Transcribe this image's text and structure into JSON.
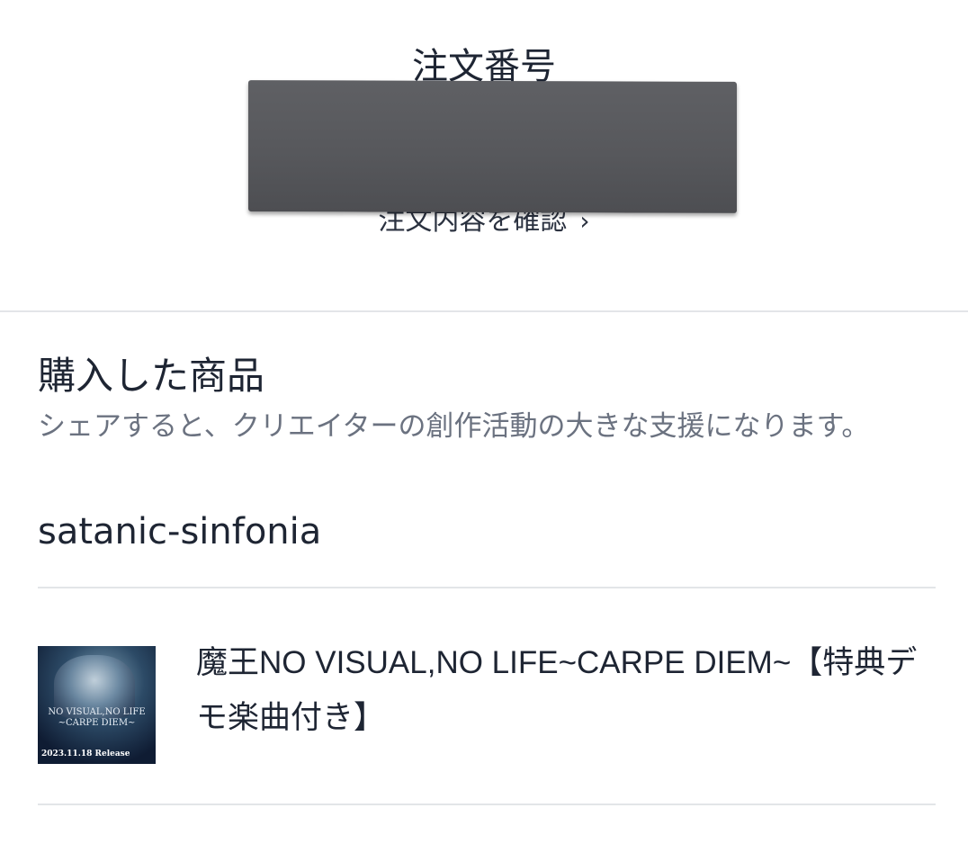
{
  "order": {
    "title": "注文番号",
    "link_label": "注文内容を確認",
    "link_chevron": "›"
  },
  "purchased": {
    "title": "購入した商品",
    "subtitle": "シェアすると、クリエイターの創作活動の大きな支援になります。",
    "creator": "satanic-sinfonia",
    "items": [
      {
        "name": "魔王NO VISUAL,NO LIFE~CARPE DIEM~【特典デモ楽曲付き】",
        "thumb_logo": "NO VISUAL,NO LIFE ~CARPE DIEM~",
        "thumb_date": "2023.11.18 Release"
      }
    ]
  },
  "colors": {
    "text": "#1e2533",
    "subtext": "#6b7280",
    "divider": "#e3e5e8",
    "redaction": "#58595d"
  }
}
